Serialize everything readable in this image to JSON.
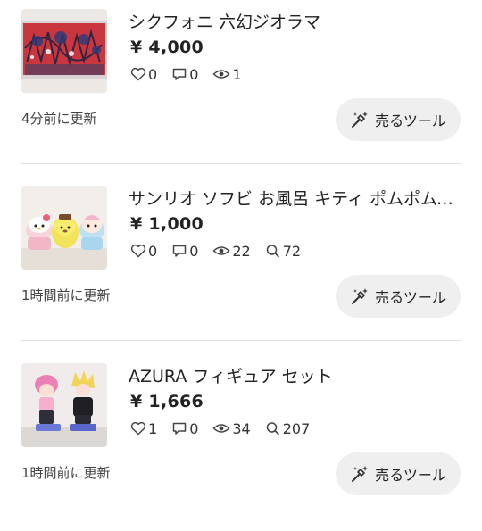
{
  "listings": [
    {
      "thumbnail": "diorama-figure-photo",
      "title": "シクフォニ 六幻ジオラマ",
      "price": "¥ 4,000",
      "likes": "0",
      "comments": "0",
      "views": "1",
      "searches": null,
      "updated": "4分前に更新",
      "sell_tool_label": "売るツール"
    },
    {
      "thumbnail": "sanrio-sofubi-photo",
      "title": "サンリオ ソフビ お風呂 キティ ポムポムプリン",
      "price": "¥ 1,000",
      "likes": "0",
      "comments": "0",
      "views": "22",
      "searches": "72",
      "updated": "1時間前に更新",
      "sell_tool_label": "売るツール"
    },
    {
      "thumbnail": "azura-figure-photo",
      "title": "AZURA フィギュア セット",
      "price": "¥ 1,666",
      "likes": "1",
      "comments": "0",
      "views": "34",
      "searches": "207",
      "updated": "1時間前に更新",
      "sell_tool_label": "売るツール"
    }
  ],
  "icons": {
    "like": "heart-icon",
    "comment": "comment-icon",
    "view": "eye-icon",
    "search": "search-icon",
    "sell_tool": "sparkle-hammer-icon"
  }
}
